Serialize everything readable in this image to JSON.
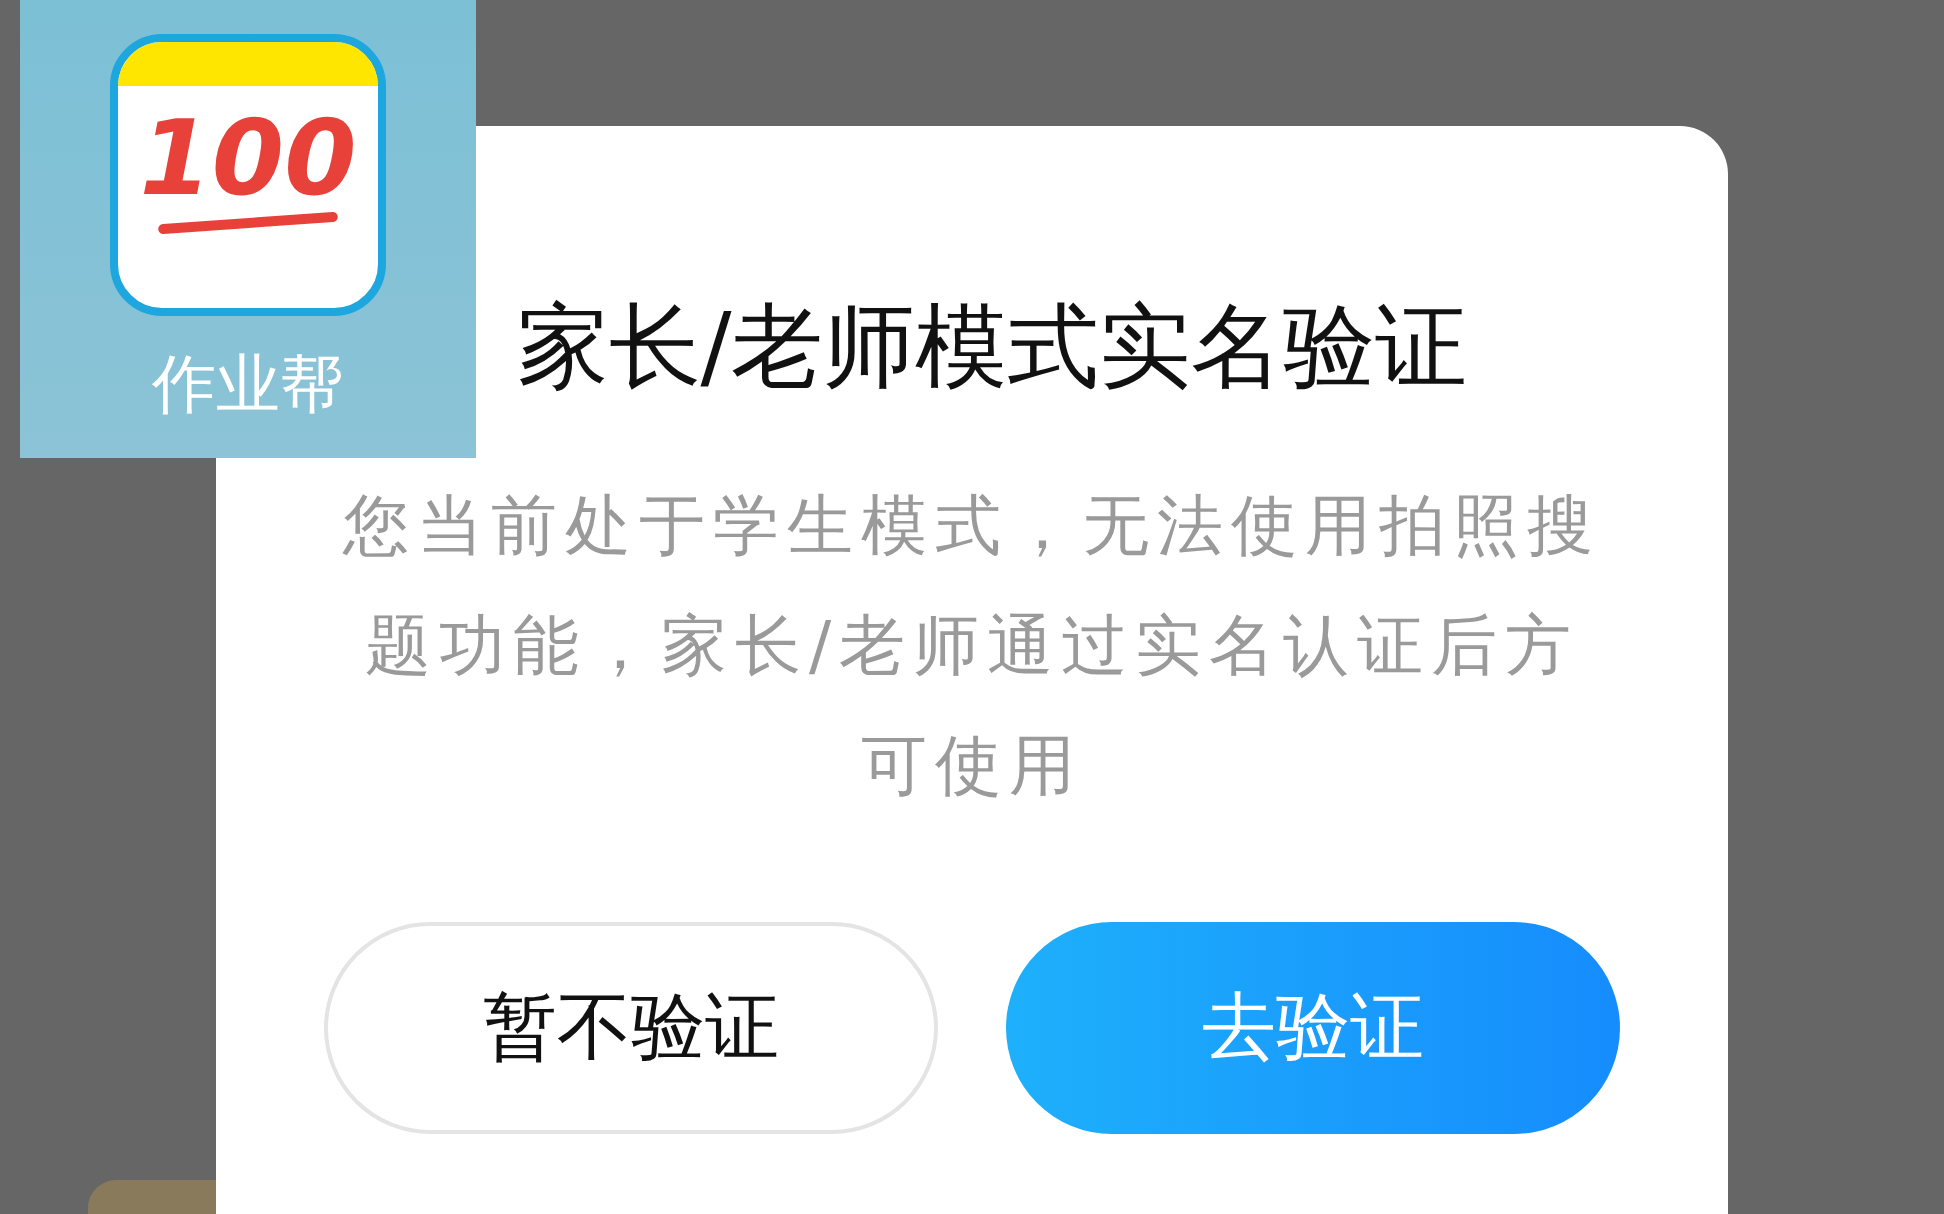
{
  "app_badge": {
    "label": "作业帮",
    "logo_text": "100"
  },
  "dialog": {
    "title": "家长/老师模式实名验证",
    "message": "您当前处于学生模式，无法使用拍照搜题功能，家长/老师通过实名认证后方可使用",
    "buttons": [
      {
        "label": "暂不验证",
        "kind": "secondary"
      },
      {
        "label": "去验证",
        "kind": "primary"
      }
    ]
  }
}
